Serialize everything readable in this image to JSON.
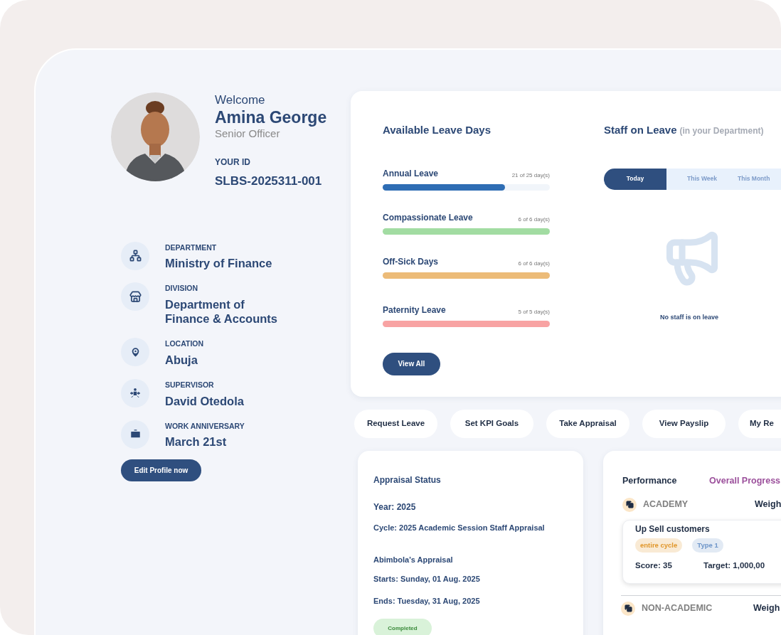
{
  "profile": {
    "greeting": "Welcome",
    "name": "Amina George",
    "role": "Senior Officer",
    "id_label": "YOUR ID",
    "id_value": "SLBS-2025311-001"
  },
  "details": [
    {
      "label": "DEPARTMENT",
      "value": "Ministry of Finance"
    },
    {
      "label": "DIVISION",
      "value": "Department of Finance & Accounts"
    },
    {
      "label": "LOCATION",
      "value": "Abuja"
    },
    {
      "label": "SUPERVISOR",
      "value": "David Otedola"
    },
    {
      "label": "WORK ANNIVERSARY",
      "value": "March 21st"
    }
  ],
  "edit_button": "Edit Profile now",
  "leave_card": {
    "title": "Available Leave Days",
    "types": [
      {
        "name": "Annual Leave",
        "reading": "21 of 25 day(s)",
        "level": 0.73,
        "color": "#2e6db4"
      },
      {
        "name": "Compassionate Leave",
        "reading": "6 of 6 day(s)",
        "level": 1,
        "color": "#a2dca2"
      },
      {
        "name": "Off-Sick Days",
        "reading": "6 of 6 day(s)",
        "level": 1,
        "color": "#ecbb78"
      },
      {
        "name": "Paternity Leave",
        "reading": "5 of 5 day(s)",
        "level": 1,
        "color": "#f8a3a3"
      }
    ],
    "button": "View All"
  },
  "staff_on_leave": {
    "title": "Staff on Leave",
    "subtitle": "(in your Department)",
    "tabs": [
      {
        "label": "Today",
        "selected": true
      },
      {
        "label": "This Week",
        "selected": false
      },
      {
        "label": "This Month",
        "selected": false
      }
    ],
    "empty_message": "No staff is on leave"
  },
  "quick_actions": [
    "Request Leave",
    "Set KPI Goals",
    "Take Appraisal",
    "View Payslip",
    "My Re"
  ],
  "appraisal": {
    "title": "Appraisal Status",
    "year": "Year: 2025",
    "cycle": "Cycle: 2025 Academic Session Staff Appraisal",
    "name": "Abimbola’s Appraisal",
    "starts": "Starts: Sunday, 01 Aug. 2025",
    "ends": "Ends: Tuesday, 31 Aug, 2025",
    "status": "Completed"
  },
  "performance": {
    "title": "Performance",
    "progress_label": "Overall Progress",
    "sections": [
      {
        "name": "ACADEMY",
        "column": "Weigh",
        "kpis": [
          {
            "title": "Up Sell customers",
            "tags": [
              {
                "label": "entire cycle",
                "color": "#e0962a"
              },
              {
                "label": "Type 1",
                "color": "#6d95c9"
              }
            ],
            "score": "Score: 35",
            "target": "Target: 1,000,00"
          }
        ]
      },
      {
        "name": "NON-ACADEMIC",
        "column": "Weigh"
      }
    ]
  }
}
